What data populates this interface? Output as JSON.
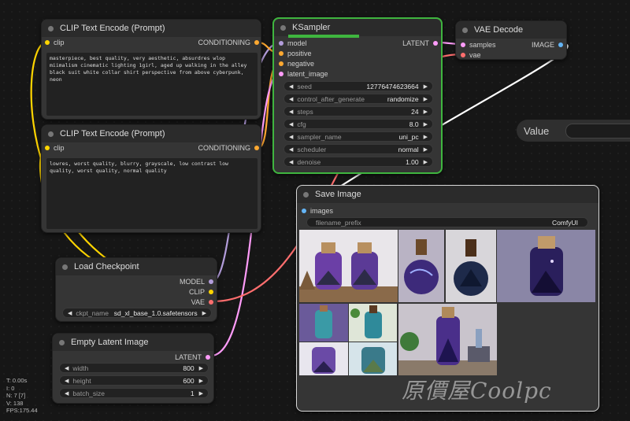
{
  "colors": {
    "model": "#b39ddb",
    "clip": "#ffd500",
    "conditioning": "#ffa931",
    "latent": "#ff9cf9",
    "vae": "#ff6e6e",
    "image": "#64b5f6",
    "selected": "#3fb53f"
  },
  "nodes": {
    "clip_pos": {
      "title": "CLIP Text Encode (Prompt)",
      "input_clip": "clip",
      "output": "CONDITIONING",
      "text": "masterpiece, best quality, very aesthetic, absurdres wlop miimalism cinematic lighting 1girl, aged up walking in the alley black suit white collar shirt perspective from above cyberpunk, neon"
    },
    "clip_neg": {
      "title": "CLIP Text Encode (Prompt)",
      "input_clip": "clip",
      "output": "CONDITIONING",
      "text": "lowres, worst quality, blurry, grayscale, low contrast low quality, worst quality, normal quality"
    },
    "ksampler": {
      "title": "KSampler",
      "inputs": [
        "model",
        "positive",
        "negative",
        "latent_image"
      ],
      "output": "LATENT",
      "progress_fraction": 0.5,
      "widgets": [
        {
          "label": "seed",
          "value": "12776474623664"
        },
        {
          "label": "control_after_generate",
          "value": "randomize"
        },
        {
          "label": "steps",
          "value": "24"
        },
        {
          "label": "cfg",
          "value": "8.0"
        },
        {
          "label": "sampler_name",
          "value": "uni_pc"
        },
        {
          "label": "scheduler",
          "value": "normal"
        },
        {
          "label": "denoise",
          "value": "1.00"
        }
      ]
    },
    "vae_decode": {
      "title": "VAE Decode",
      "input_samples": "samples",
      "input_vae": "vae",
      "output": "IMAGE"
    },
    "value": {
      "label": "Value"
    },
    "save_image": {
      "title": "Save Image",
      "input": "images",
      "prefix_label": "filename_prefix",
      "prefix_value": "ComfyUI"
    },
    "checkpoint": {
      "title": "Load Checkpoint",
      "outputs": [
        "MODEL",
        "CLIP",
        "VAE"
      ],
      "ckpt_label": "ckpt_name",
      "ckpt_value": "sd_xl_base_1.0.safetensors"
    },
    "latent": {
      "title": "Empty Latent Image",
      "output": "LATENT",
      "widgets": [
        {
          "label": "width",
          "value": "800"
        },
        {
          "label": "height",
          "value": "600"
        },
        {
          "label": "batch_size",
          "value": "1"
        }
      ]
    }
  },
  "stats": {
    "t": "T: 0.00s",
    "i": "I: 0",
    "n": "N: 7 [7]",
    "v": "V: 138",
    "fps": "FPS:175.44"
  },
  "watermark": "原價屋Coolpc"
}
